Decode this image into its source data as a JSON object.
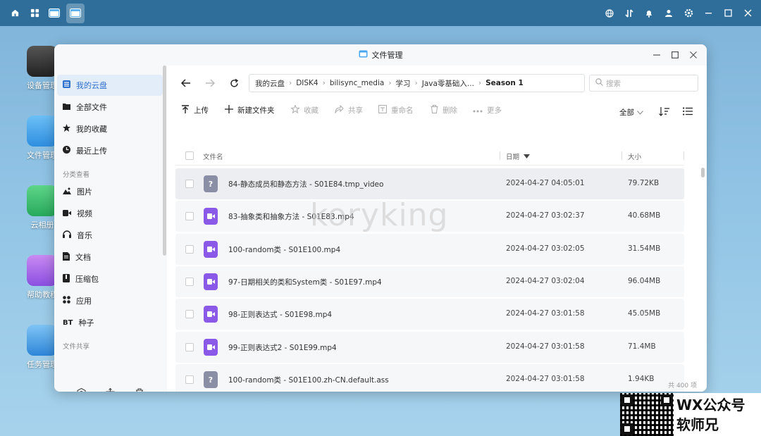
{
  "topbar": {
    "left_icons": [
      "home-icon",
      "apps-grid-icon",
      "window-icon",
      "file-manager-icon"
    ],
    "right_icons": [
      "globe-icon",
      "transfer-icon",
      "bell-icon",
      "user-icon",
      "settings-icon",
      "minimize-icon",
      "maximize-icon",
      "close-icon"
    ]
  },
  "desktop": {
    "icons": [
      {
        "label": "设备管理",
        "name": "device-manager"
      },
      {
        "label": "文件管理",
        "name": "file-manager"
      },
      {
        "label": "云相册",
        "name": "cloud-album"
      },
      {
        "label": "帮助教程",
        "name": "help-tutorial"
      },
      {
        "label": "任务管理",
        "name": "task-manager"
      }
    ]
  },
  "window": {
    "title": "文件管理"
  },
  "sidebar": {
    "items": [
      {
        "label": "我的云盘",
        "icon": "list-icon",
        "active": true
      },
      {
        "label": "全部文件",
        "icon": "folder-icon"
      },
      {
        "label": "我的收藏",
        "icon": "star-icon"
      },
      {
        "label": "最近上传",
        "icon": "clock-icon"
      }
    ],
    "section_category": "分类查看",
    "category_items": [
      {
        "label": "图片",
        "icon": "image-icon"
      },
      {
        "label": "视频",
        "icon": "video-icon"
      },
      {
        "label": "音乐",
        "icon": "headphones-icon"
      },
      {
        "label": "文档",
        "icon": "document-icon"
      },
      {
        "label": "压缩包",
        "icon": "archive-icon"
      },
      {
        "label": "应用",
        "icon": "apps-icon"
      },
      {
        "label": "种子",
        "icon": "bt-icon",
        "prefix": "BT"
      }
    ],
    "section_share": "文件共享"
  },
  "nav": {
    "breadcrumb": [
      "我的云盘",
      "DISK4",
      "bilisync_media",
      "学习",
      "Java零基础入...",
      "Season 1"
    ],
    "search_placeholder": "搜索"
  },
  "toolbar": {
    "upload": "上传",
    "new_folder": "新建文件夹",
    "favorite": "收藏",
    "share": "共享",
    "rename": "重命名",
    "delete": "删除",
    "more": "更多",
    "filter": "全部"
  },
  "table": {
    "headers": {
      "name": "文件名",
      "date": "日期",
      "size": "大小"
    },
    "rows": [
      {
        "name": "84-静态成员和静态方法 - S01E84.tmp_video",
        "date": "2024-04-27 04:05:01",
        "size": "79.72KB",
        "type": "unknown"
      },
      {
        "name": "83-抽象类和抽象方法 - S01E83.mp4",
        "date": "2024-04-27 03:02:37",
        "size": "40.68MB",
        "type": "video"
      },
      {
        "name": "100-random类 - S01E100.mp4",
        "date": "2024-04-27 03:02:05",
        "size": "31.54MB",
        "type": "video"
      },
      {
        "name": "97-日期相关的类和System类 - S01E97.mp4",
        "date": "2024-04-27 03:02:04",
        "size": "96.04MB",
        "type": "video"
      },
      {
        "name": "98-正则表达式 - S01E98.mp4",
        "date": "2024-04-27 03:01:58",
        "size": "45.05MB",
        "type": "video"
      },
      {
        "name": "99-正则表达式2 - S01E99.mp4",
        "date": "2024-04-27 03:01:58",
        "size": "71.4MB",
        "type": "video"
      },
      {
        "name": "100-random类 - S01E100.zh-CN.default.ass",
        "date": "2024-04-27 03:01:58",
        "size": "1.94KB",
        "type": "unknown"
      }
    ],
    "footer": "共 400 项"
  },
  "overlay": {
    "watermark": "koryking",
    "promo_line1": "WX公众号",
    "promo_line2": "软师兄"
  },
  "colors": {
    "accent": "#2f6fce",
    "video_icon": "#8b59e8",
    "unknown_icon": "#8a8fa5",
    "topbar": "#2f6e9b"
  }
}
